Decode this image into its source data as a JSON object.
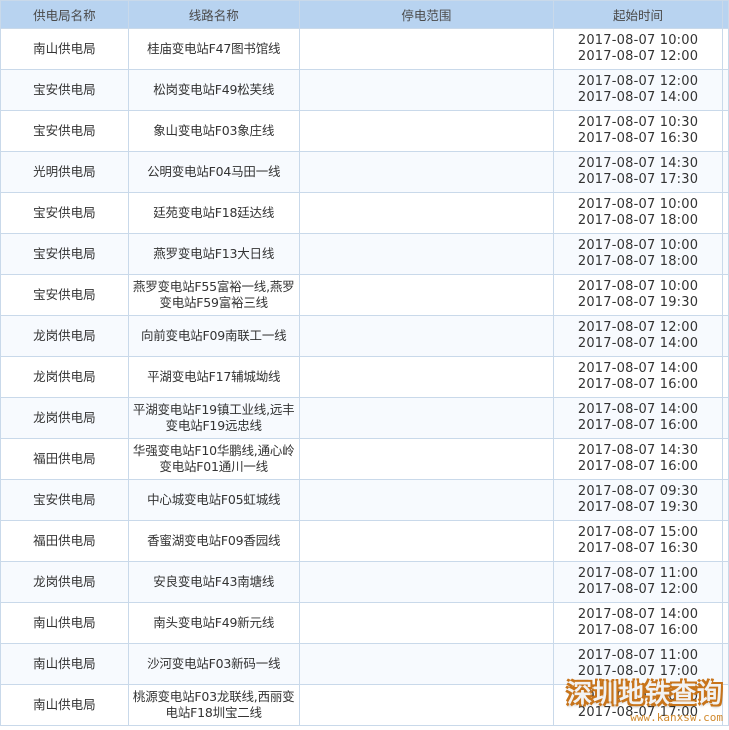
{
  "table": {
    "headers": [
      "供电局名称",
      "线路名称",
      "停电范围",
      "起始时间"
    ],
    "rows": [
      {
        "bureau": "南山供电局",
        "line": "桂庙变电站F47图书馆线",
        "range": "",
        "start": "2017-08-07 10:00",
        "end": "2017-08-07 12:00"
      },
      {
        "bureau": "宝安供电局",
        "line": "松岗变电站F49松芙线",
        "range": "",
        "start": "2017-08-07 12:00",
        "end": "2017-08-07 14:00"
      },
      {
        "bureau": "宝安供电局",
        "line": "象山变电站F03象庄线",
        "range": "",
        "start": "2017-08-07 10:30",
        "end": "2017-08-07 16:30"
      },
      {
        "bureau": "光明供电局",
        "line": "公明变电站F04马田一线",
        "range": "",
        "start": "2017-08-07 14:30",
        "end": "2017-08-07 17:30"
      },
      {
        "bureau": "宝安供电局",
        "line": "廷苑变电站F18廷达线",
        "range": "",
        "start": "2017-08-07 10:00",
        "end": "2017-08-07 18:00"
      },
      {
        "bureau": "宝安供电局",
        "line": "燕罗变电站F13大日线",
        "range": "",
        "start": "2017-08-07 10:00",
        "end": "2017-08-07 18:00"
      },
      {
        "bureau": "宝安供电局",
        "line": "燕罗变电站F55富裕一线,燕罗变电站F59富裕三线",
        "range": "",
        "start": "2017-08-07 10:00",
        "end": "2017-08-07 19:30"
      },
      {
        "bureau": "龙岗供电局",
        "line": "向前变电站F09南联工一线",
        "range": "",
        "start": "2017-08-07 12:00",
        "end": "2017-08-07 14:00"
      },
      {
        "bureau": "龙岗供电局",
        "line": "平湖变电站F17辅城坳线",
        "range": "",
        "start": "2017-08-07 14:00",
        "end": "2017-08-07 16:00"
      },
      {
        "bureau": "龙岗供电局",
        "line": "平湖变电站F19镇工业线,远丰变电站F19远忠线",
        "range": "",
        "start": "2017-08-07 14:00",
        "end": "2017-08-07 16:00"
      },
      {
        "bureau": "福田供电局",
        "line": "华强变电站F10华鹏线,通心岭变电站F01通川一线",
        "range": "",
        "start": "2017-08-07 14:30",
        "end": "2017-08-07 16:00"
      },
      {
        "bureau": "宝安供电局",
        "line": "中心城变电站F05虹城线",
        "range": "",
        "start": "2017-08-07 09:30",
        "end": "2017-08-07 19:30"
      },
      {
        "bureau": "福田供电局",
        "line": "香蜜湖变电站F09香园线",
        "range": "",
        "start": "2017-08-07 15:00",
        "end": "2017-08-07 16:30"
      },
      {
        "bureau": "龙岗供电局",
        "line": "安良变电站F43南塘线",
        "range": "",
        "start": "2017-08-07 11:00",
        "end": "2017-08-07 12:00"
      },
      {
        "bureau": "南山供电局",
        "line": "南头变电站F49新元线",
        "range": "",
        "start": "2017-08-07 14:00",
        "end": "2017-08-07 16:00"
      },
      {
        "bureau": "南山供电局",
        "line": "沙河变电站F03新码一线",
        "range": "",
        "start": "2017-08-07 11:00",
        "end": "2017-08-07 17:00"
      },
      {
        "bureau": "南山供电局",
        "line": "桃源变电站F03龙联线,西丽变电站F18圳宝二线",
        "range": "",
        "start": "2017-08-07 10:00",
        "end": "2017-08-07 17:00"
      }
    ]
  },
  "watermark": {
    "title": "深圳地铁查询",
    "url": "www.kanxsw.com"
  }
}
